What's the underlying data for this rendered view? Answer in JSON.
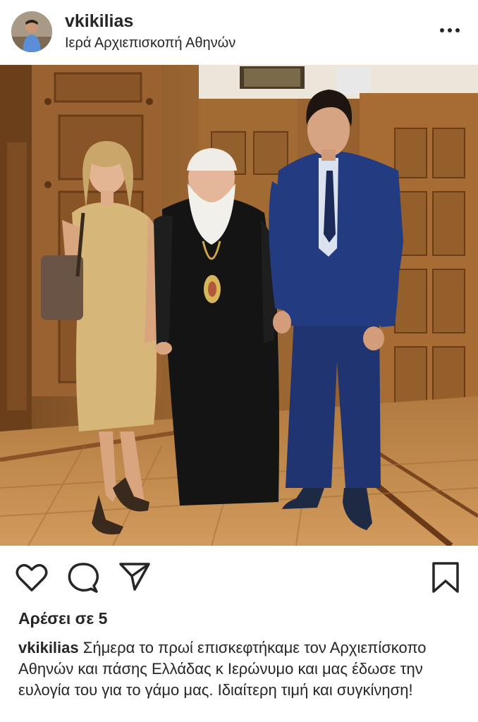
{
  "post": {
    "username": "vkikilias",
    "location": "Ιερά Αρχιεπισκοπή Αθηνών",
    "likes_text": "Αρέσει σε 5",
    "caption_user": "vkikilias",
    "caption_text": " Σήμερα το πρωί επισκεφτήκαμε τον Αρχιεπίσκοπο Αθηνών και πάσης Ελλάδας κ Ιερώνυμο και μας έδωσε την ευλογία του για το γάμο μας. Ιδιαίτερη τιμή και συγκίνηση!"
  },
  "icons": {
    "more": "more-options-icon",
    "like": "heart-icon",
    "comment": "comment-icon",
    "share": "share-icon",
    "save": "bookmark-icon"
  },
  "colors": {
    "text": "#262626",
    "background": "#ffffff",
    "photo_wood": "#8a5a2c",
    "photo_floor": "#c18a4e",
    "suit": "#1f3470",
    "cassock": "#141414",
    "dress": "#d6b679"
  }
}
